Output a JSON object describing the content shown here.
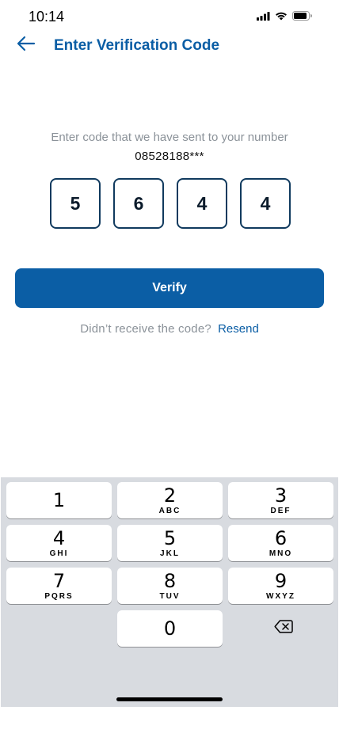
{
  "status_bar": {
    "time": "10:14"
  },
  "header": {
    "title": "Enter Verification Code"
  },
  "instruction": "Enter code that we have sent to your number",
  "phone_number": "08528188***",
  "code_digits": [
    "5",
    "6",
    "4",
    "4"
  ],
  "verify_button": "Verify",
  "resend": {
    "prompt": "Didn’t receive the code?",
    "link": "Resend"
  },
  "keypad": {
    "keys": [
      {
        "digit": "1",
        "letters": ""
      },
      {
        "digit": "2",
        "letters": "ABC"
      },
      {
        "digit": "3",
        "letters": "DEF"
      },
      {
        "digit": "4",
        "letters": "GHI"
      },
      {
        "digit": "5",
        "letters": "JKL"
      },
      {
        "digit": "6",
        "letters": "MNO"
      },
      {
        "digit": "7",
        "letters": "PQRS"
      },
      {
        "digit": "8",
        "letters": "TUV"
      },
      {
        "digit": "9",
        "letters": "WXYZ"
      },
      {
        "digit": "0",
        "letters": ""
      }
    ],
    "delete_icon": "backspace-icon"
  },
  "colors": {
    "brand": "#0b5ea5",
    "muted_text": "#8b9299",
    "code_border": "#103a5e",
    "keypad_bg": "#d8dbe0"
  }
}
